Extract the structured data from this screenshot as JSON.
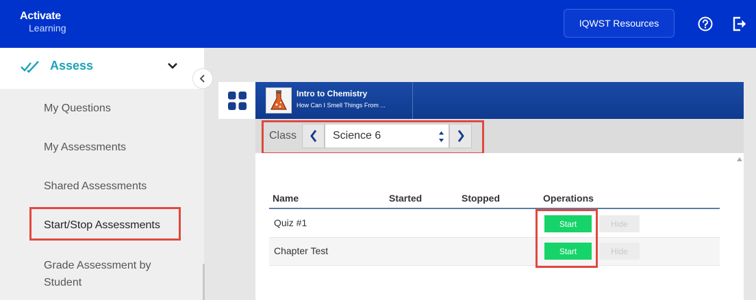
{
  "header": {
    "logo_line1": "Activate",
    "logo_line2": "Learning",
    "resources_label": "IQWST Resources",
    "help_icon": "help-circle-icon",
    "logout_icon": "logout-icon"
  },
  "sidebar": {
    "section_label": "Assess",
    "section_icon": "double-check-icon",
    "items": [
      {
        "label": "My Questions"
      },
      {
        "label": "My Assessments"
      },
      {
        "label": "Shared Assessments"
      },
      {
        "label": "Start/Stop Assessments"
      },
      {
        "label": "Grade Assessment by Student"
      }
    ]
  },
  "banner": {
    "title": "Intro to Chemistry",
    "subtitle": "How Can I Smell Things From ..."
  },
  "class_selector": {
    "label": "Class",
    "selected": "Science 6"
  },
  "table": {
    "headers": [
      "Name",
      "Started",
      "Stopped",
      "Operations"
    ],
    "rows": [
      {
        "name": "Quiz #1",
        "started": "",
        "stopped": "",
        "start_label": "Start",
        "hide_label": "Hide"
      },
      {
        "name": "Chapter Test",
        "started": "",
        "stopped": "",
        "start_label": "Start",
        "hide_label": "Hide"
      }
    ]
  },
  "colors": {
    "topbar": "#0033cc",
    "accent": "#1aa3b5",
    "highlight": "#e0483e",
    "start_button": "#16d46a"
  }
}
